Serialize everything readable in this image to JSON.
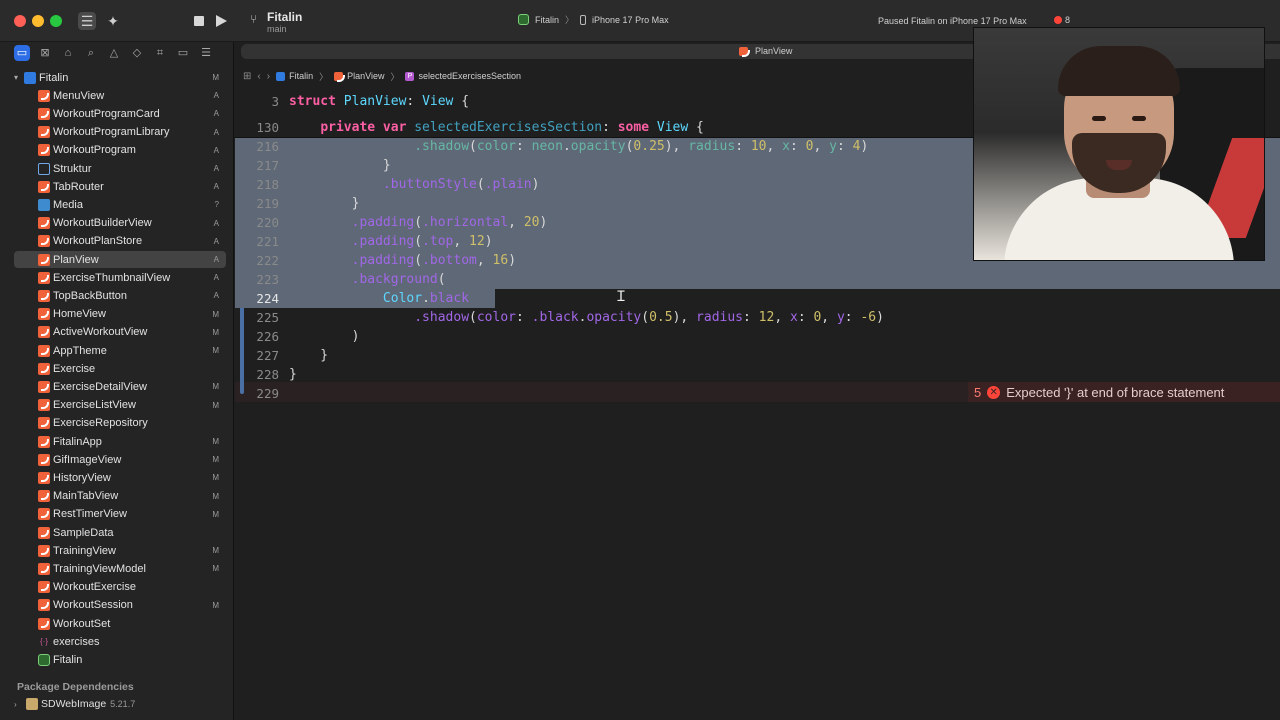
{
  "titlebar": {
    "project_name": "Fitalin",
    "branch": "main",
    "scheme_app": "Fitalin",
    "scheme_device": "iPhone 17 Pro Max",
    "status": "Paused Fitalin on iPhone 17 Pro Max",
    "error_count": "8"
  },
  "navigator": {
    "root": {
      "label": "Fitalin",
      "badge": "M",
      "icon": "project-icon"
    },
    "items": [
      {
        "label": "MenuView",
        "badge": "A",
        "icon": "swift-file-icon"
      },
      {
        "label": "WorkoutProgramCard",
        "badge": "A",
        "icon": "swift-file-icon"
      },
      {
        "label": "WorkoutProgramLibrary",
        "badge": "A",
        "icon": "swift-file-icon"
      },
      {
        "label": "WorkoutProgram",
        "badge": "A",
        "icon": "swift-file-icon"
      },
      {
        "label": "Struktur",
        "badge": "A",
        "icon": "book-icon"
      },
      {
        "label": "TabRouter",
        "badge": "A",
        "icon": "swift-file-icon"
      },
      {
        "label": "Media",
        "badge": "?",
        "icon": "assets-icon"
      },
      {
        "label": "WorkoutBuilderView",
        "badge": "A",
        "icon": "swift-file-icon"
      },
      {
        "label": "WorkoutPlanStore",
        "badge": "A",
        "icon": "swift-file-icon"
      },
      {
        "label": "PlanView",
        "badge": "A",
        "icon": "swift-file-icon",
        "selected": true
      },
      {
        "label": "ExerciseThumbnailView",
        "badge": "A",
        "icon": "swift-file-icon"
      },
      {
        "label": "TopBackButton",
        "badge": "A",
        "icon": "swift-file-icon"
      },
      {
        "label": "HomeView",
        "badge": "M",
        "icon": "swift-file-icon"
      },
      {
        "label": "ActiveWorkoutView",
        "badge": "M",
        "icon": "swift-file-icon"
      },
      {
        "label": "AppTheme",
        "badge": "M",
        "icon": "swift-file-icon"
      },
      {
        "label": "Exercise",
        "badge": "",
        "icon": "swift-file-icon"
      },
      {
        "label": "ExerciseDetailView",
        "badge": "M",
        "icon": "swift-file-icon"
      },
      {
        "label": "ExerciseListView",
        "badge": "M",
        "icon": "swift-file-icon"
      },
      {
        "label": "ExerciseRepository",
        "badge": "",
        "icon": "swift-file-icon"
      },
      {
        "label": "FitalinApp",
        "badge": "M",
        "icon": "swift-file-icon"
      },
      {
        "label": "GifImageView",
        "badge": "M",
        "icon": "swift-file-icon"
      },
      {
        "label": "HistoryView",
        "badge": "M",
        "icon": "swift-file-icon"
      },
      {
        "label": "MainTabView",
        "badge": "M",
        "icon": "swift-file-icon"
      },
      {
        "label": "RestTimerView",
        "badge": "M",
        "icon": "swift-file-icon"
      },
      {
        "label": "SampleData",
        "badge": "",
        "icon": "swift-file-icon"
      },
      {
        "label": "TrainingView",
        "badge": "M",
        "icon": "swift-file-icon"
      },
      {
        "label": "TrainingViewModel",
        "badge": "M",
        "icon": "swift-file-icon"
      },
      {
        "label": "WorkoutExercise",
        "badge": "",
        "icon": "swift-file-icon"
      },
      {
        "label": "WorkoutSession",
        "badge": "M",
        "icon": "swift-file-icon"
      },
      {
        "label": "WorkoutSet",
        "badge": "",
        "icon": "swift-file-icon"
      },
      {
        "label": "exercises",
        "badge": "",
        "icon": "json-file-icon"
      },
      {
        "label": "Fitalin",
        "badge": "",
        "icon": "app-icon"
      }
    ],
    "package_header": "Package Dependencies",
    "packages": [
      {
        "name": "SDWebImage",
        "version": "5.21.7"
      }
    ]
  },
  "editor": {
    "tab_label": "PlanView",
    "breadcrumb": [
      "Fitalin",
      "PlanView",
      "selectedExercisesSection"
    ],
    "error_message": "Expected '}' at end of brace statement",
    "error_count": "5",
    "error_line": "229"
  },
  "code_lines": [
    {
      "n": "3",
      "sticky": true,
      "tokens": [
        [
          "k",
          "struct "
        ],
        [
          "t",
          "PlanView"
        ],
        [
          "p",
          ": "
        ],
        [
          "t",
          "View"
        ],
        [
          "p",
          " {"
        ]
      ]
    },
    {
      "n": "130",
      "sticky": true,
      "tokens": [
        [
          "p",
          "    "
        ],
        [
          "k",
          "private var "
        ],
        [
          "id",
          "selectedExercisesSection"
        ],
        [
          "p",
          ": "
        ],
        [
          "k",
          "some "
        ],
        [
          "t",
          "View"
        ],
        [
          "p",
          " {"
        ]
      ]
    },
    {
      "n": "216",
      "sel": true,
      "tokens": [
        [
          "p",
          "                "
        ],
        [
          "f",
          ".shadow"
        ],
        [
          "p",
          "("
        ],
        [
          "f",
          "color"
        ],
        [
          "p",
          ": "
        ],
        [
          "f",
          "neon"
        ],
        [
          "p",
          "."
        ],
        [
          "f",
          "opacity"
        ],
        [
          "p",
          "("
        ],
        [
          "n",
          "0.25"
        ],
        [
          "p",
          "), "
        ],
        [
          "f",
          "radius"
        ],
        [
          "p",
          ": "
        ],
        [
          "n",
          "10"
        ],
        [
          "p",
          ", "
        ],
        [
          "f",
          "x"
        ],
        [
          "p",
          ": "
        ],
        [
          "n",
          "0"
        ],
        [
          "p",
          ", "
        ],
        [
          "f",
          "y"
        ],
        [
          "p",
          ": "
        ],
        [
          "n",
          "4"
        ],
        [
          "p",
          ")"
        ]
      ]
    },
    {
      "n": "217",
      "sel": true,
      "tokens": [
        [
          "p",
          "            }"
        ]
      ]
    },
    {
      "n": "218",
      "sel": true,
      "tokens": [
        [
          "p",
          "            "
        ],
        [
          "m",
          ".buttonStyle"
        ],
        [
          "p",
          "("
        ],
        [
          "m",
          ".plain"
        ],
        [
          "p",
          ")"
        ]
      ]
    },
    {
      "n": "219",
      "sel": true,
      "tokens": [
        [
          "p",
          "        }"
        ]
      ]
    },
    {
      "n": "220",
      "sel": true,
      "tokens": [
        [
          "p",
          "        "
        ],
        [
          "m",
          ".padding"
        ],
        [
          "p",
          "("
        ],
        [
          "m",
          ".horizontal"
        ],
        [
          "p",
          ", "
        ],
        [
          "n",
          "20"
        ],
        [
          "p",
          ")"
        ]
      ]
    },
    {
      "n": "221",
      "sel": true,
      "tokens": [
        [
          "p",
          "        "
        ],
        [
          "m",
          ".padding"
        ],
        [
          "p",
          "("
        ],
        [
          "m",
          ".top"
        ],
        [
          "p",
          ", "
        ],
        [
          "n",
          "12"
        ],
        [
          "p",
          ")"
        ]
      ]
    },
    {
      "n": "222",
      "sel": true,
      "tokens": [
        [
          "p",
          "        "
        ],
        [
          "m",
          ".padding"
        ],
        [
          "p",
          "("
        ],
        [
          "m",
          ".bottom"
        ],
        [
          "p",
          ", "
        ],
        [
          "n",
          "16"
        ],
        [
          "p",
          ")"
        ]
      ]
    },
    {
      "n": "223",
      "sel": true,
      "tokens": [
        [
          "p",
          "        "
        ],
        [
          "m",
          ".background"
        ],
        [
          "p",
          "("
        ]
      ]
    },
    {
      "n": "224",
      "cur": true,
      "partial": true,
      "tokens": [
        [
          "p",
          "            "
        ],
        [
          "t",
          "Color"
        ],
        [
          "p",
          "."
        ],
        [
          "m",
          "black"
        ]
      ]
    },
    {
      "n": "225",
      "tokens": [
        [
          "p",
          "                "
        ],
        [
          "m",
          ".shadow"
        ],
        [
          "p",
          "("
        ],
        [
          "m",
          "color"
        ],
        [
          "p",
          ": "
        ],
        [
          "m",
          ".black"
        ],
        [
          "p",
          "."
        ],
        [
          "m",
          "opacity"
        ],
        [
          "p",
          "("
        ],
        [
          "n",
          "0.5"
        ],
        [
          "p",
          "), "
        ],
        [
          "m",
          "radius"
        ],
        [
          "p",
          ": "
        ],
        [
          "n",
          "12"
        ],
        [
          "p",
          ", "
        ],
        [
          "m",
          "x"
        ],
        [
          "p",
          ": "
        ],
        [
          "n",
          "0"
        ],
        [
          "p",
          ", "
        ],
        [
          "m",
          "y"
        ],
        [
          "p",
          ": "
        ],
        [
          "n",
          "-6"
        ],
        [
          "p",
          ")"
        ]
      ]
    },
    {
      "n": "226",
      "tokens": [
        [
          "p",
          "        )"
        ]
      ]
    },
    {
      "n": "227",
      "tokens": [
        [
          "p",
          "    }"
        ]
      ]
    },
    {
      "n": "228",
      "tokens": [
        [
          "p",
          "}"
        ]
      ]
    },
    {
      "n": "229",
      "tokens": []
    }
  ],
  "colors": {
    "accent": "#2d6ee6",
    "selection": "#5e6877",
    "error": "#ff453a",
    "keyword": "#fc5fa3",
    "type": "#5dd8ff",
    "number": "#d0bf69"
  }
}
